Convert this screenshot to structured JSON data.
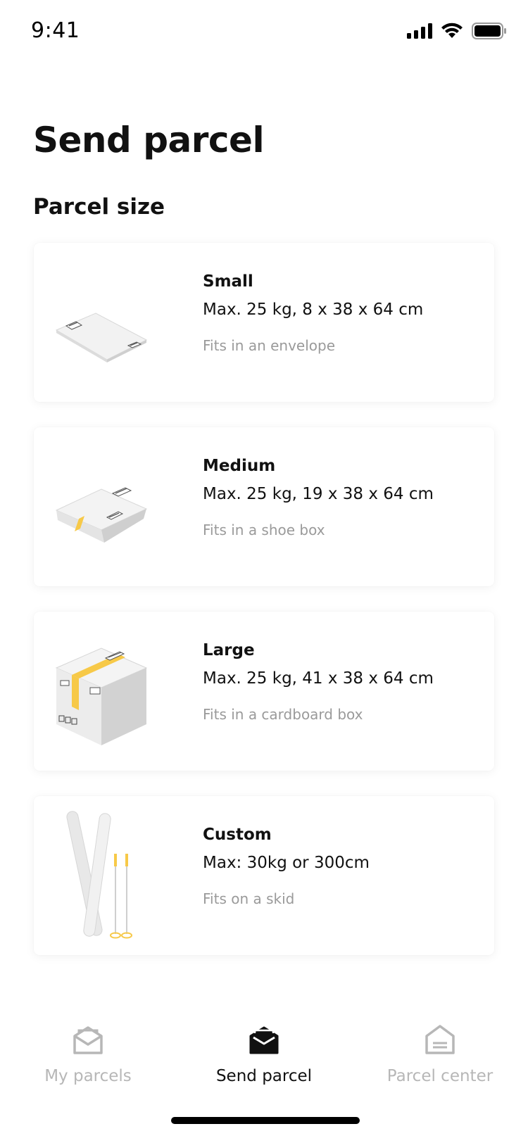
{
  "status_bar": {
    "time": "9:41"
  },
  "page": {
    "title": "Send parcel",
    "section_title": "Parcel size"
  },
  "parcels": [
    {
      "name": "Small",
      "spec": "Max. 25 kg, 8 x 38 x 64 cm",
      "description": "Fits in an envelope",
      "icon": "envelope-parcel-icon"
    },
    {
      "name": "Medium",
      "spec": "Max. 25 kg, 19 x 38 x 64 cm",
      "description": "Fits in a shoe box",
      "icon": "padded-bag-parcel-icon"
    },
    {
      "name": "Large",
      "spec": "Max. 25 kg, 41 x 38 x 64 cm",
      "description": "Fits in a cardboard box",
      "icon": "cardboard-box-icon"
    },
    {
      "name": "Custom",
      "spec": "Max: 30kg or 300cm",
      "description": "Fits on a skid",
      "icon": "skis-icon"
    }
  ],
  "bottom_nav": {
    "items": [
      {
        "label": "My parcels",
        "icon": "open-envelope-outline-icon",
        "active": false
      },
      {
        "label": "Send parcel",
        "icon": "open-envelope-filled-icon",
        "active": true
      },
      {
        "label": "Parcel center",
        "icon": "parcel-center-icon",
        "active": false
      }
    ]
  },
  "colors": {
    "accent_yellow": "#f7c948",
    "text_primary": "#111111",
    "text_secondary": "#9a9a9a",
    "nav_inactive": "#b7b7b7"
  }
}
